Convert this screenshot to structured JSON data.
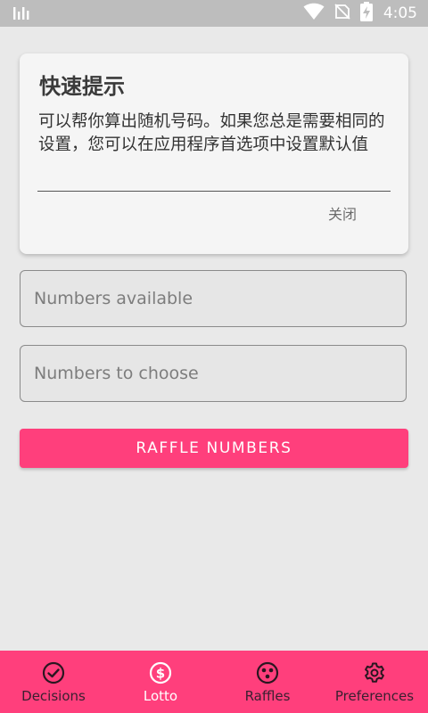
{
  "status_bar": {
    "time": "4:05",
    "icons": [
      "signal-icon",
      "wifi-icon",
      "no-sim-icon",
      "battery-charging-icon"
    ]
  },
  "tip_card": {
    "title": "快速提示",
    "body": "可以帮你算出随机号码。如果您总是需要相同的设置，您可以在应用程序首选项中设置默认值",
    "close_label": "关闭"
  },
  "form": {
    "numbers_available_placeholder": "Numbers available",
    "numbers_available_value": "",
    "numbers_to_choose_placeholder": "Numbers to choose",
    "numbers_to_choose_value": "",
    "raffle_button_label": "RAFFLE NUMBERS"
  },
  "bottom_nav": {
    "items": [
      {
        "label": "Decisions",
        "icon": "check-circle-icon",
        "active": false
      },
      {
        "label": "Lotto",
        "icon": "dollar-circle-icon",
        "active": true
      },
      {
        "label": "Raffles",
        "icon": "raffle-balls-icon",
        "active": false
      },
      {
        "label": "Preferences",
        "icon": "gear-icon",
        "active": false
      }
    ]
  },
  "colors": {
    "accent": "#ff3f7c",
    "background": "#e9e9e9",
    "status_bar": "#bdbdbd",
    "card": "#f5f5f5",
    "nav_inactive_text": "#3a2030",
    "nav_active_text": "#ffffff"
  }
}
